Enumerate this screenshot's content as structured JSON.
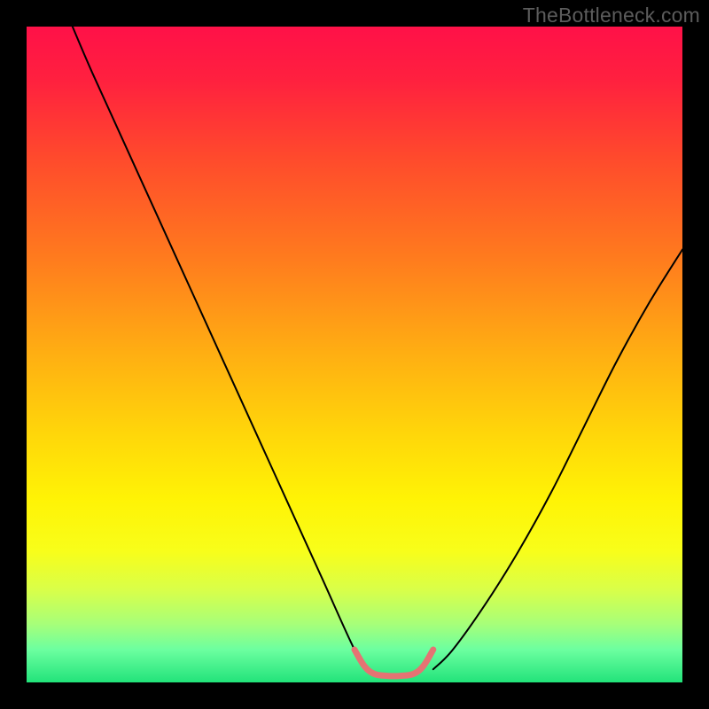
{
  "watermark": "TheBottleneck.com",
  "gradient_stops": [
    {
      "offset": 0.0,
      "color": "#ff1148"
    },
    {
      "offset": 0.08,
      "color": "#ff203f"
    },
    {
      "offset": 0.2,
      "color": "#ff4a2c"
    },
    {
      "offset": 0.35,
      "color": "#ff7a1e"
    },
    {
      "offset": 0.5,
      "color": "#ffaf12"
    },
    {
      "offset": 0.62,
      "color": "#ffd60a"
    },
    {
      "offset": 0.72,
      "color": "#fff305"
    },
    {
      "offset": 0.8,
      "color": "#f8fe1a"
    },
    {
      "offset": 0.86,
      "color": "#d8ff4a"
    },
    {
      "offset": 0.91,
      "color": "#a8ff78"
    },
    {
      "offset": 0.95,
      "color": "#6cffa0"
    },
    {
      "offset": 1.0,
      "color": "#22e37a"
    }
  ],
  "chart_data": {
    "type": "line",
    "title": "",
    "xlabel": "",
    "ylabel": "",
    "xlim": [
      0,
      100
    ],
    "ylim": [
      0,
      100
    ],
    "series": [
      {
        "name": "left-branch",
        "color": "#000000",
        "width": 2,
        "x": [
          7,
          10,
          15,
          20,
          25,
          30,
          35,
          40,
          45,
          50,
          52
        ],
        "y": [
          100,
          93,
          82,
          71,
          60,
          49,
          38,
          27,
          16,
          5,
          2
        ]
      },
      {
        "name": "right-branch",
        "color": "#000000",
        "width": 2,
        "x": [
          62,
          65,
          70,
          75,
          80,
          85,
          90,
          95,
          100
        ],
        "y": [
          2,
          5,
          12,
          20,
          29,
          39,
          49,
          58,
          66
        ]
      },
      {
        "name": "valley-highlight",
        "color": "#e57373",
        "width": 7,
        "x": [
          50,
          51.5,
          53,
          55,
          57,
          59,
          60.5,
          62
        ],
        "y": [
          5,
          2.5,
          1.3,
          1,
          1,
          1.3,
          2.5,
          5
        ]
      }
    ]
  }
}
